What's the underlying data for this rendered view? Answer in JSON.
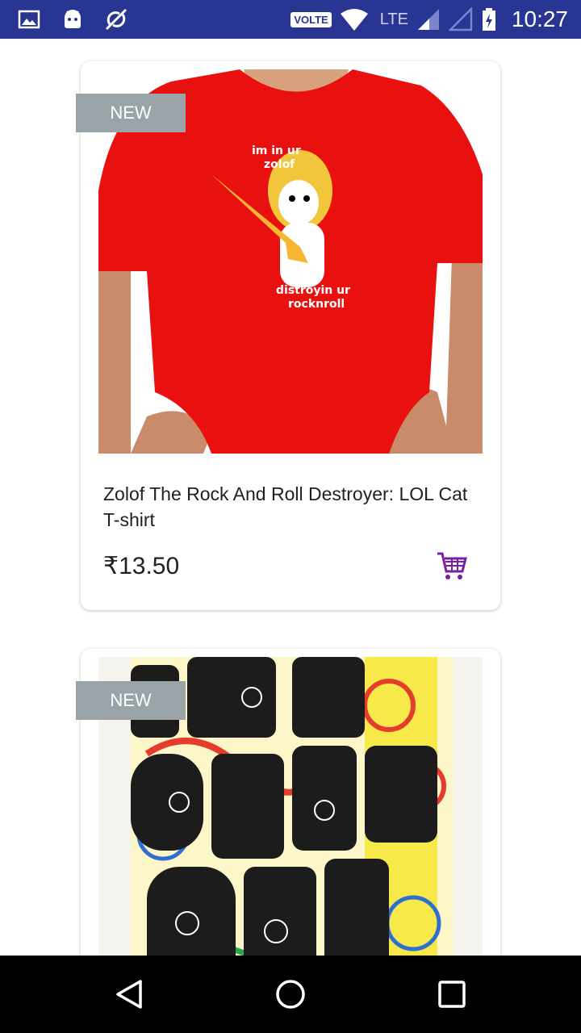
{
  "status_bar": {
    "volte": "VOLTE",
    "network": "LTE",
    "time": "10:27",
    "icons": [
      "image-icon",
      "android-icon",
      "no-sync-icon",
      "wifi-icon",
      "signal-icon",
      "signal-empty-icon",
      "battery-charging-icon"
    ]
  },
  "products": [
    {
      "badge": "NEW",
      "title": "Zolof The Rock And Roll Destroyer: LOL Cat T-shirt",
      "price": "₹13.50",
      "image_icon": "red-tshirt-image",
      "image_text": [
        "im in ur",
        "zolof",
        "distroyin ur",
        "rocknroll"
      ]
    },
    {
      "badge": "NEW",
      "image_icon": "paisley-tshirt-image"
    }
  ],
  "colors": {
    "status_bar": "#283593",
    "badge": "#9aa3a7",
    "cart_icon": "#7b1fa2",
    "tshirt_red": "#e8110f"
  },
  "nav": {
    "icons": [
      "back-icon",
      "home-icon",
      "recents-icon"
    ]
  }
}
